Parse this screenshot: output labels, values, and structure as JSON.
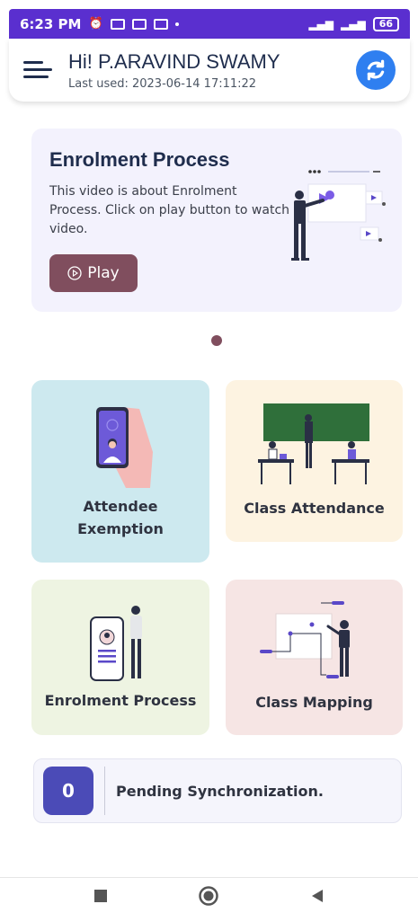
{
  "status_bar": {
    "time": "6:23 PM",
    "battery": "66"
  },
  "header": {
    "greeting": "Hi! P.ARAVIND SWAMY",
    "last_used": "Last used: 2023-06-14 17:11:22"
  },
  "banner": {
    "title": "Enrolment Process",
    "description": "This video is about Enrolment Process. Click on play button to watch video.",
    "play_label": "Play"
  },
  "tiles": [
    {
      "label": "Attendee\nExemption",
      "color": "#cde9ef"
    },
    {
      "label": "Class Attendance",
      "color": "#fdf3e1"
    },
    {
      "label": "Enrolment Process",
      "color": "#eef4e2"
    },
    {
      "label": "Class Mapping",
      "color": "#f6e5e4"
    }
  ],
  "pending": {
    "count": "0",
    "label": "Pending Synchronization."
  },
  "colors": {
    "status_bar": "#5a2fcf",
    "accent_blue": "#2f7ff0",
    "play_button": "#804e5e",
    "pending_badge": "#4b4bb7"
  }
}
